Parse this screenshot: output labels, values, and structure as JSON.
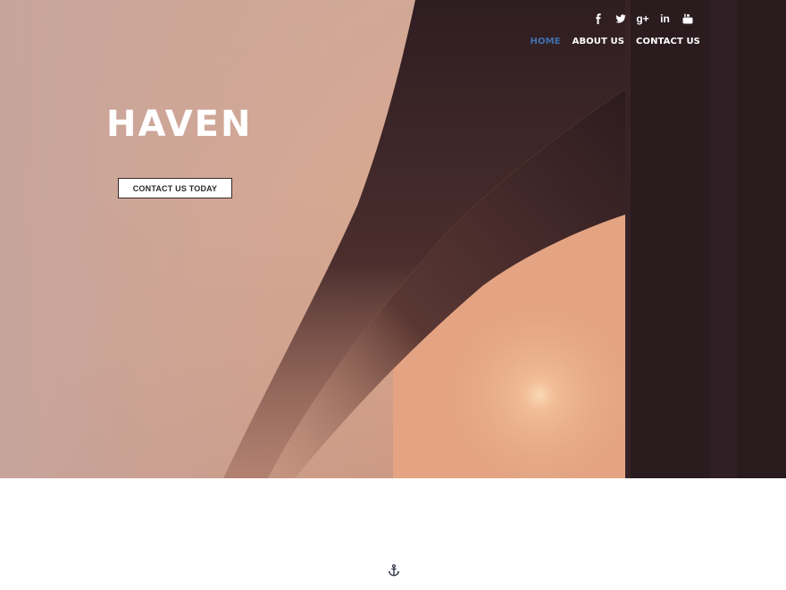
{
  "hero": {
    "title": "HAVEN",
    "cta_label": "CONTACT US TODAY"
  },
  "social": [
    {
      "name": "facebook-icon",
      "glyph": "f"
    },
    {
      "name": "twitter-icon"
    },
    {
      "name": "google-plus-icon",
      "glyph": "g+"
    },
    {
      "name": "linkedin-icon",
      "glyph": "in"
    },
    {
      "name": "youtube-icon"
    }
  ],
  "nav": {
    "items": [
      {
        "label": "HOME",
        "active": true
      },
      {
        "label": "ABOUT US",
        "active": false
      },
      {
        "label": "CONTACT US",
        "active": false
      }
    ]
  },
  "colors": {
    "accent": "#3f6fae",
    "hero_tint": "#d9a78e",
    "dark": "#2b1a1d"
  },
  "section_icon": "anchor-icon"
}
